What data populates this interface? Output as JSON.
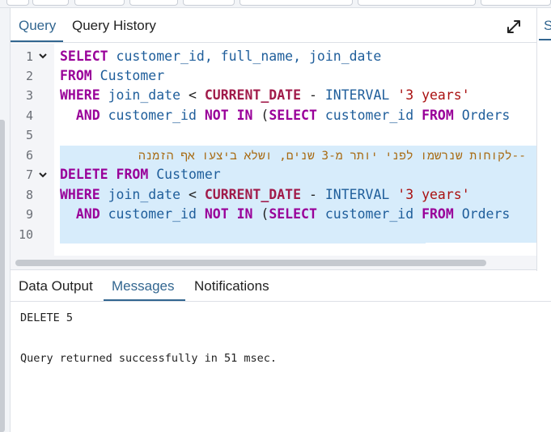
{
  "editor_tabs": {
    "query_label": "Query",
    "history_label": "Query History",
    "expand_icon": "expand-arrows-icon"
  },
  "right_panel": {
    "tab_label": "S"
  },
  "editor": {
    "line_numbers": [
      "1",
      "2",
      "3",
      "4",
      "5",
      "6",
      "7",
      "8",
      "9",
      "10"
    ],
    "lines": {
      "l1": {
        "kw1": "SELECT",
        "ids": " customer_id, full_name, join_date"
      },
      "l2": {
        "kw1": "FROM",
        "tbl": " Customer"
      },
      "l3": {
        "kw1": "WHERE",
        "col": " join_date ",
        "op": "<",
        "fn": " CURRENT_DATE",
        "op2": " - ",
        "iv": "INTERVAL",
        "str": " '3 years'"
      },
      "l4": {
        "indent": "  ",
        "kw1": "AND",
        "col": " customer_id ",
        "kw2": "NOT IN",
        "paren": " (",
        "kw3": "SELECT",
        "col2": " customer_id ",
        "kw4": "FROM",
        "tbl": " Orders"
      },
      "l6": {
        "comment": "--לקוחות שנרשמו לפני יותר מ-3 שנים, ושלא ביצעו אף הזמנה"
      },
      "l7": {
        "kw1": "DELETE FROM",
        "tbl": " Customer"
      },
      "l8": {
        "kw1": "WHERE",
        "col": " join_date ",
        "op": "<",
        "fn": " CURRENT_DATE",
        "op2": " - ",
        "iv": "INTERVAL",
        "str": " '3 years'"
      },
      "l9": {
        "indent": "  ",
        "kw1": "AND",
        "col": " customer_id ",
        "kw2": "NOT IN",
        "paren": " (",
        "kw3": "SELECT",
        "col2": " customer_id ",
        "kw4": "FROM",
        "tbl": " Orders"
      }
    }
  },
  "output_tabs": {
    "data_output": "Data Output",
    "messages": "Messages",
    "notifications": "Notifications"
  },
  "messages": {
    "line1": "DELETE 5",
    "line2": "Query returned successfully in 51 msec."
  }
}
